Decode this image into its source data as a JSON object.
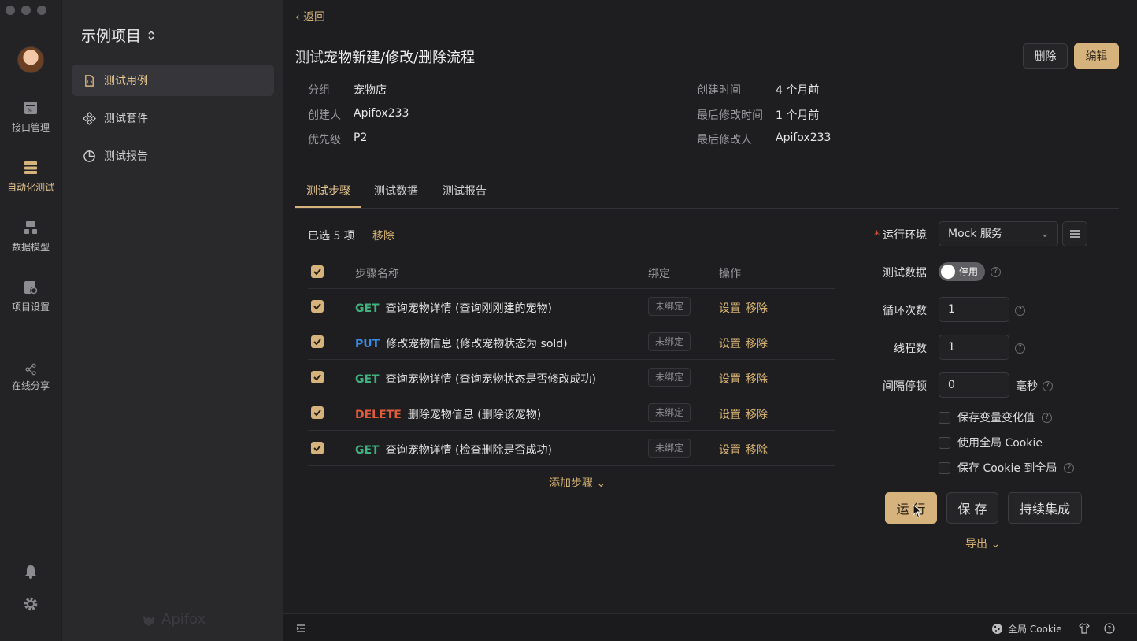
{
  "rail": {
    "items": [
      {
        "label": "接口管理",
        "icon": "api-icon"
      },
      {
        "label": "自动化测试",
        "icon": "automation-icon",
        "active": true
      },
      {
        "label": "数据模型",
        "icon": "data-model-icon"
      },
      {
        "label": "项目设置",
        "icon": "settings-icon"
      },
      {
        "label": "在线分享",
        "icon": "share-icon"
      }
    ]
  },
  "sidebar": {
    "project": "示例项目",
    "items": [
      {
        "label": "测试用例",
        "icon": "testcase-icon",
        "active": true
      },
      {
        "label": "测试套件",
        "icon": "suite-icon"
      },
      {
        "label": "测试报告",
        "icon": "report-icon"
      }
    ],
    "watermark": "Apifox"
  },
  "header": {
    "back": "返回",
    "title": "测试宠物新建/修改/删除流程",
    "delete_label": "删除",
    "edit_label": "编辑"
  },
  "meta": {
    "group_label": "分组",
    "group": "宠物店",
    "creator_label": "创建人",
    "creator": "Apifox233",
    "priority_label": "优先级",
    "priority": "P2",
    "created_label": "创建时间",
    "created": "4 个月前",
    "modified_label": "最后修改时间",
    "modified": "1 个月前",
    "modifier_label": "最后修改人",
    "modifier": "Apifox233"
  },
  "tabs": [
    {
      "label": "测试步骤",
      "active": true
    },
    {
      "label": "测试数据"
    },
    {
      "label": "测试报告"
    }
  ],
  "steps": {
    "selected_info": "已选 5 项",
    "remove_selected": "移除",
    "headers": {
      "name": "步骤名称",
      "bind": "绑定",
      "ops": "操作"
    },
    "rows": [
      {
        "method": "GET",
        "name": "查询宠物详情 (查询刚刚建的宠物)",
        "bind": "未绑定",
        "checked": true
      },
      {
        "method": "PUT",
        "name": "修改宠物信息 (修改宠物状态为 sold)",
        "bind": "未绑定",
        "checked": true
      },
      {
        "method": "GET",
        "name": "查询宠物详情 (查询宠物状态是否修改成功)",
        "bind": "未绑定",
        "checked": true
      },
      {
        "method": "DELETE",
        "name": "删除宠物信息 (删除该宠物)",
        "bind": "未绑定",
        "checked": true
      },
      {
        "method": "GET",
        "name": "查询宠物详情 (检查删除是否成功)",
        "bind": "未绑定",
        "checked": true
      }
    ],
    "op_settings": "设置",
    "op_remove": "移除",
    "add_step": "添加步骤"
  },
  "run": {
    "env_label": "运行环境",
    "env_value": "Mock 服务",
    "test_data_label": "测试数据",
    "test_data_toggle": "停用",
    "loop_label": "循环次数",
    "loop_value": "1",
    "threads_label": "线程数",
    "threads_value": "1",
    "interval_label": "间隔停顿",
    "interval_value": "0",
    "interval_unit": "毫秒",
    "opt_save_vars": "保存变量变化值",
    "opt_global_cookie": "使用全局 Cookie",
    "opt_save_cookie": "保存 Cookie 到全局",
    "run_label": "运 行",
    "save_label": "保 存",
    "ci_label": "持续集成",
    "export_label": "导出"
  },
  "statusbar": {
    "cookie_label": "全局 Cookie"
  },
  "colors": {
    "accent": "#d6b27c",
    "get": "#3fb27f",
    "put": "#3b8ce8",
    "delete": "#e25c3c"
  }
}
